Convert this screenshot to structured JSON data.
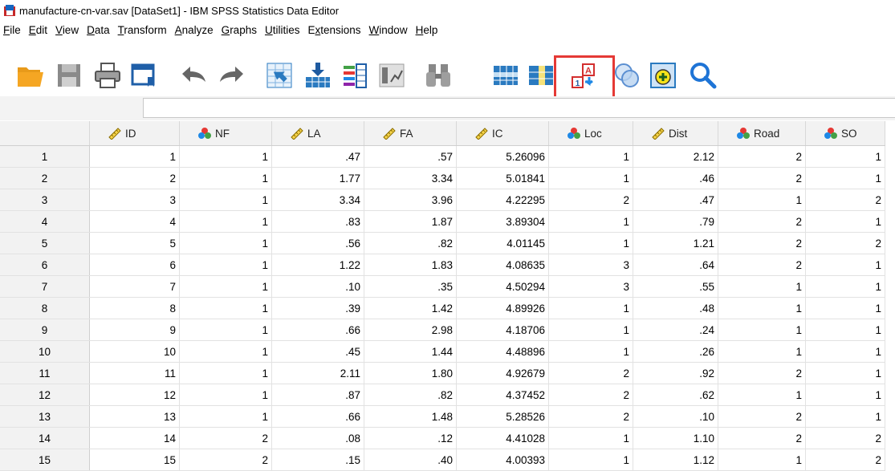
{
  "window": {
    "title": "manufacture-cn-var.sav [DataSet1] - IBM SPSS Statistics Data Editor"
  },
  "menu": [
    {
      "label": "File",
      "u": "F",
      "rest": "ile"
    },
    {
      "label": "Edit",
      "u": "E",
      "rest": "dit"
    },
    {
      "label": "View",
      "u": "V",
      "rest": "iew"
    },
    {
      "label": "Data",
      "u": "D",
      "rest": "ata"
    },
    {
      "label": "Transform",
      "u": "T",
      "rest": "ransform"
    },
    {
      "label": "Analyze",
      "u": "A",
      "rest": "nalyze"
    },
    {
      "label": "Graphs",
      "u": "G",
      "rest": "raphs"
    },
    {
      "label": "Utilities",
      "u": "U",
      "rest": "tilities"
    },
    {
      "label": "Extensions",
      "pre": "E",
      "u": "x",
      "rest": "tensions"
    },
    {
      "label": "Window",
      "u": "W",
      "rest": "indow"
    },
    {
      "label": "Help",
      "u": "H",
      "rest": "elp"
    }
  ],
  "toolbar": {
    "icons": [
      "open-folder-icon",
      "save-icon",
      "print-icon",
      "recall-dialog-icon",
      "undo-icon",
      "redo-icon",
      "goto-case-icon",
      "goto-variable-icon",
      "variables-icon",
      "run-descriptives-icon",
      "find-icon",
      "insert-cases-icon",
      "insert-variable-icon",
      "value-labels-icon",
      "use-variable-sets-icon",
      "show-all-variables-icon",
      "spell-check-icon"
    ]
  },
  "cell_editor": {
    "value": ""
  },
  "grid": {
    "columns": [
      {
        "name": "ID",
        "type": "scale"
      },
      {
        "name": "NF",
        "type": "nominal"
      },
      {
        "name": "LA",
        "type": "scale"
      },
      {
        "name": "FA",
        "type": "scale"
      },
      {
        "name": "IC",
        "type": "scale"
      },
      {
        "name": "Loc",
        "type": "nominal"
      },
      {
        "name": "Dist",
        "type": "scale"
      },
      {
        "name": "Road",
        "type": "nominal"
      },
      {
        "name": "SO",
        "type": "nominal"
      }
    ],
    "rows": [
      [
        "1",
        "1",
        "1",
        ".47",
        ".57",
        "5.26096",
        "1",
        "2.12",
        "2",
        "1"
      ],
      [
        "2",
        "2",
        "1",
        "1.77",
        "3.34",
        "5.01841",
        "1",
        ".46",
        "2",
        "1"
      ],
      [
        "3",
        "3",
        "1",
        "3.34",
        "3.96",
        "4.22295",
        "2",
        ".47",
        "1",
        "2"
      ],
      [
        "4",
        "4",
        "1",
        ".83",
        "1.87",
        "3.89304",
        "1",
        ".79",
        "2",
        "1"
      ],
      [
        "5",
        "5",
        "1",
        ".56",
        ".82",
        "4.01145",
        "1",
        "1.21",
        "2",
        "2"
      ],
      [
        "6",
        "6",
        "1",
        "1.22",
        "1.83",
        "4.08635",
        "3",
        ".64",
        "2",
        "1"
      ],
      [
        "7",
        "7",
        "1",
        ".10",
        ".35",
        "4.50294",
        "3",
        ".55",
        "1",
        "1"
      ],
      [
        "8",
        "8",
        "1",
        ".39",
        "1.42",
        "4.89926",
        "1",
        ".48",
        "1",
        "1"
      ],
      [
        "9",
        "9",
        "1",
        ".66",
        "2.98",
        "4.18706",
        "1",
        ".24",
        "1",
        "1"
      ],
      [
        "10",
        "10",
        "1",
        ".45",
        "1.44",
        "4.48896",
        "1",
        ".26",
        "1",
        "1"
      ],
      [
        "11",
        "11",
        "1",
        "2.11",
        "1.80",
        "4.92679",
        "2",
        ".92",
        "2",
        "1"
      ],
      [
        "12",
        "12",
        "1",
        ".87",
        ".82",
        "4.37452",
        "2",
        ".62",
        "1",
        "1"
      ],
      [
        "13",
        "13",
        "1",
        ".66",
        "1.48",
        "5.28526",
        "2",
        ".10",
        "2",
        "1"
      ],
      [
        "14",
        "14",
        "2",
        ".08",
        ".12",
        "4.41028",
        "1",
        "1.10",
        "2",
        "2"
      ],
      [
        "15",
        "15",
        "2",
        ".15",
        ".40",
        "4.00393",
        "1",
        "1.12",
        "1",
        "2"
      ]
    ]
  }
}
